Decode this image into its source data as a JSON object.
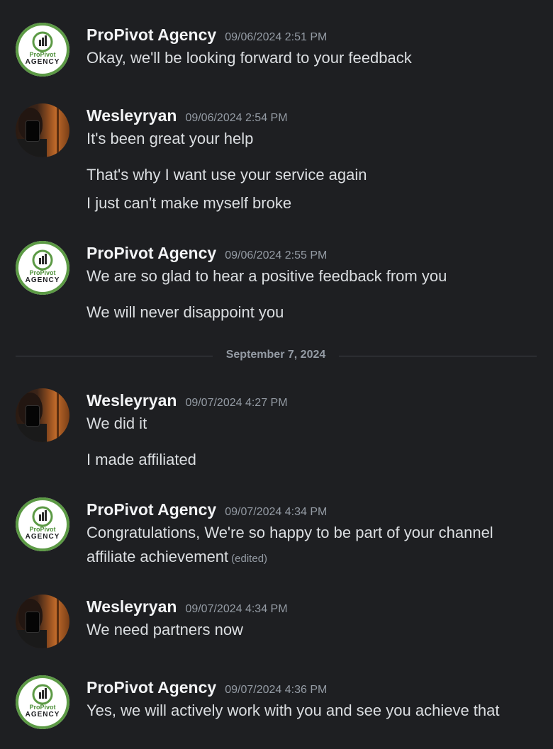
{
  "messages": [
    {
      "author": "ProPivot Agency",
      "timestamp": "09/06/2024 2:51 PM",
      "lines": [
        "Okay, we'll be looking forward to your feedback"
      ]
    },
    {
      "author": "Wesleyryan",
      "timestamp": "09/06/2024 2:54 PM",
      "lines": [
        "It's been great your help",
        "That's why I want use your service again",
        "I just can't make myself broke"
      ]
    },
    {
      "author": "ProPivot Agency",
      "timestamp": "09/06/2024 2:55 PM",
      "lines": [
        "We are so glad to hear a positive feedback from you",
        "We will never disappoint you"
      ]
    },
    {
      "author": "Wesleyryan",
      "timestamp": "09/07/2024 4:27 PM",
      "lines": [
        "We did it",
        "I made affiliated"
      ]
    },
    {
      "author": "ProPivot Agency",
      "timestamp": "09/07/2024 4:34 PM",
      "lines": [
        "Congratulations, We're so happy to be part of your channel",
        "affiliate achievement"
      ],
      "edited": "(edited)"
    },
    {
      "author": "Wesleyryan",
      "timestamp": "09/07/2024 4:34 PM",
      "lines": [
        "We need partners now"
      ]
    },
    {
      "author": "ProPivot Agency",
      "timestamp": "09/07/2024 4:36 PM",
      "lines": [
        "Yes, we will actively work with you and see you achieve that"
      ]
    }
  ],
  "date_divider": "September 7, 2024",
  "avatar_logo": {
    "pro_text": "ProPivot",
    "agency_text": "AGENCY"
  },
  "colors": {
    "background": "#1e1f22",
    "author": "#f2f3f5",
    "timestamp": "#949ba4",
    "message_text": "#dbdee1",
    "logo_green": "#5c9a45"
  }
}
